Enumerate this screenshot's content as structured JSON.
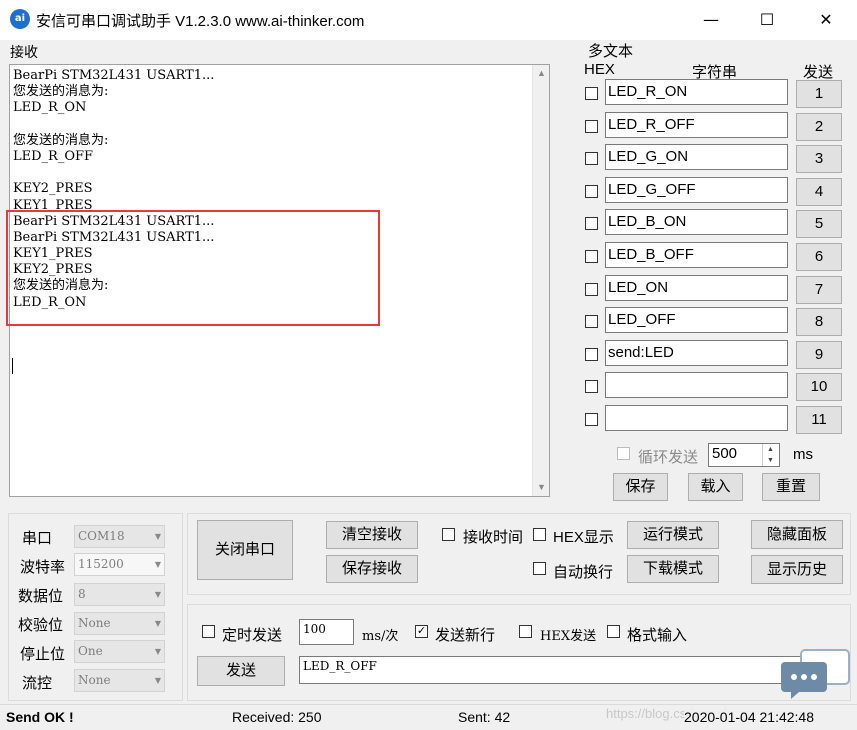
{
  "window": {
    "title": "安信可串口调试助手 V1.2.3.0    www.ai-thinker.com",
    "icon_text": "ai",
    "minimize_glyph": "—",
    "maximize_glyph": "☐",
    "close_glyph": "✕"
  },
  "receive": {
    "label": "接收",
    "lines": [
      "BearPi STM32L431 USART1...",
      "您发送的消息为:",
      "LED_R_ON",
      "",
      "您发送的消息为:",
      "LED_R_OFF",
      "",
      "KEY2_PRES",
      "KEY1_PRES",
      "BearPi STM32L431 USART1...",
      "BearPi STM32L431 USART1...",
      "KEY1_PRES",
      "KEY2_PRES",
      "您发送的消息为:",
      "LED_R_ON"
    ]
  },
  "multi": {
    "title": "多文本",
    "col_hex": "HEX",
    "col_string": "字符串",
    "col_send": "发送",
    "rows": [
      {
        "value": "LED_R_ON",
        "button": "1"
      },
      {
        "value": "LED_R_OFF",
        "button": "2"
      },
      {
        "value": "LED_G_ON",
        "button": "3"
      },
      {
        "value": "LED_G_OFF",
        "button": "4"
      },
      {
        "value": "LED_B_ON",
        "button": "5"
      },
      {
        "value": "LED_B_OFF",
        "button": "6"
      },
      {
        "value": "LED_ON",
        "button": "7"
      },
      {
        "value": "LED_OFF",
        "button": "8"
      },
      {
        "value": "send:LED",
        "button": "9"
      },
      {
        "value": "",
        "button": "10"
      },
      {
        "value": "",
        "button": "11"
      }
    ],
    "loop_label": "循环发送",
    "loop_value": "500",
    "loop_unit": "ms",
    "save": "保存",
    "load": "载入",
    "reset": "重置"
  },
  "port": {
    "port_label": "串口",
    "port_value": "COM18",
    "baud_label": "波特率",
    "baud_value": "115200",
    "data_label": "数据位",
    "data_value": "8",
    "parity_label": "校验位",
    "parity_value": "None",
    "stop_label": "停止位",
    "stop_value": "One",
    "flow_label": "流控",
    "flow_value": "None"
  },
  "controls": {
    "close_port": "关闭串口",
    "clear_recv": "清空接收",
    "save_recv": "保存接收",
    "recv_time": "接收时间",
    "hex_display": "HEX显示",
    "auto_wrap": "自动换行",
    "run_mode": "运行模式",
    "download_mode": "下载模式",
    "hide_panel": "隐藏面板",
    "show_history": "显示历史"
  },
  "send": {
    "timed_send": "定时发送",
    "interval_value": "100",
    "interval_unit": "ms/次",
    "newline": "发送新行",
    "hex_send": "HEX发送",
    "format_input": "格式输入",
    "send_button": "发送",
    "send_text": "LED_R_OFF",
    "checkmark": "✓"
  },
  "status": {
    "message": "Send OK !",
    "received": "Received: 250",
    "sent": "Sent: 42",
    "datetime": "2020-01-04 21:42:48",
    "watermark": "https://blog.csdn.net/qq_..."
  },
  "colors": {
    "highlight": "#e63a3a",
    "app_icon": "#1e6fd0"
  }
}
